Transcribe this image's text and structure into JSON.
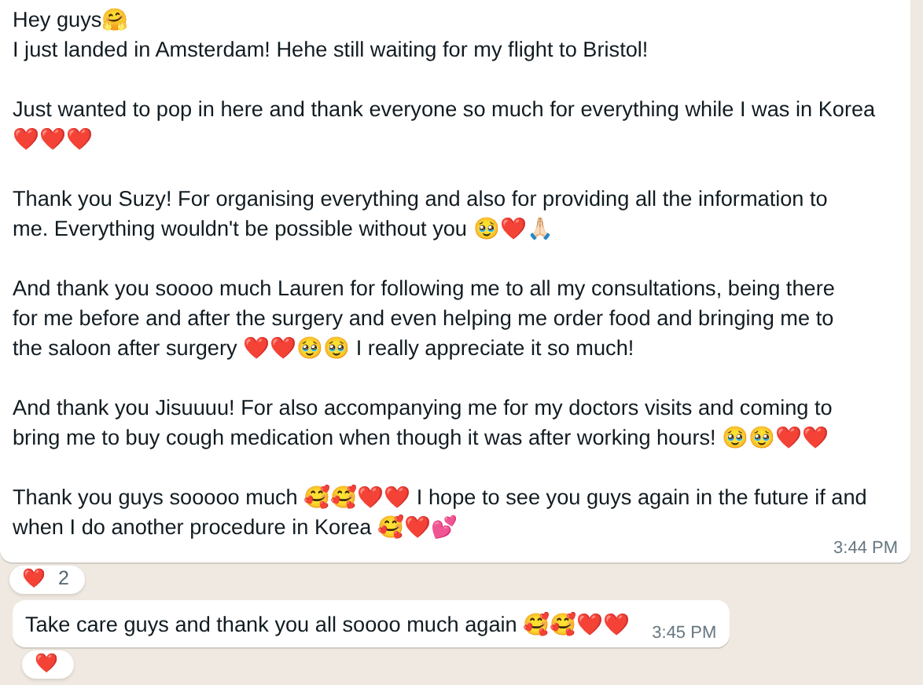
{
  "messages": [
    {
      "paragraphs": [
        "Hey guys🤗\nI just landed in Amsterdam! Hehe still waiting for my flight to Bristol!",
        "Just wanted to pop in here and thank everyone so much for everything while I was in Korea\n❤️❤️❤️",
        "Thank you Suzy! For organising everything and also for providing all the information to\nme. Everything wouldn't be possible without you 🥹❤️🙏🏻",
        "And thank you soooo much Lauren for following me to all my consultations, being there\nfor me before and after the surgery and even helping me order food and bringing me to\nthe saloon after surgery ❤️❤️🥹🥹 I really appreciate it so much!",
        "And thank you Jisuuuu! For also accompanying me for my doctors visits and coming to\nbring me to buy cough medication when though it was after working hours! 🥹🥹❤️❤️",
        "Thank you guys sooooo much 🥰🥰❤️❤️ I hope to see you guys again in the future if and\nwhen I do another procedure in Korea 🥰❤️💕"
      ],
      "time": "3:44 PM",
      "reaction": {
        "emoji": "❤️",
        "count": "2"
      }
    },
    {
      "paragraphs": [
        "Take care guys and thank you all soooo much again 🥰🥰❤️❤️"
      ],
      "time": "3:45 PM",
      "reaction": {
        "emoji": "❤️"
      }
    }
  ]
}
